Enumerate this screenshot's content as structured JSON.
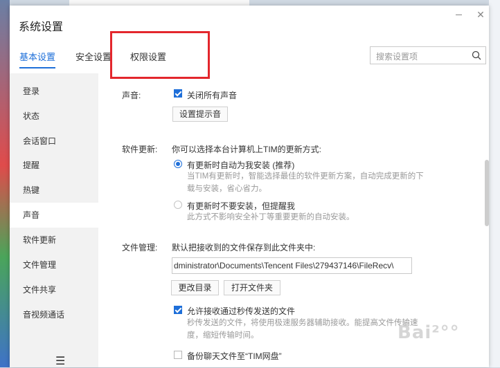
{
  "window": {
    "title": "系统设置"
  },
  "tabs": [
    {
      "label": "基本设置",
      "active": true
    },
    {
      "label": "安全设置",
      "active": false
    },
    {
      "label": "权限设置",
      "active": false
    }
  ],
  "search": {
    "placeholder": "搜索设置项"
  },
  "sidebar": {
    "items": [
      {
        "label": "登录"
      },
      {
        "label": "状态"
      },
      {
        "label": "会话窗口"
      },
      {
        "label": "提醒"
      },
      {
        "label": "热键"
      },
      {
        "label": "声音",
        "active": true
      },
      {
        "label": "软件更新"
      },
      {
        "label": "文件管理"
      },
      {
        "label": "文件共享"
      },
      {
        "label": "音视频通话"
      }
    ]
  },
  "sound": {
    "label": "声音:",
    "mute_all_label": "关闭所有声音",
    "mute_all_checked": true,
    "set_tone_button": "设置提示音"
  },
  "update": {
    "label": "软件更新:",
    "intro": "你可以选择本台计算机上TIM的更新方式:",
    "option_auto": {
      "label": "有更新时自动为我安装 (推荐)",
      "desc_line1": "当TIM有更新时，智能选择最佳的软件更新方案，自动完成更新的下",
      "desc_line2": "载与安装，省心省力。",
      "checked": true
    },
    "option_notify": {
      "label": "有更新时不要安装，但提醒我",
      "desc": "此方式不影响安全补丁等重要更新的自动安装。",
      "checked": false
    }
  },
  "file": {
    "label": "文件管理:",
    "intro": "默认把接收到的文件保存到此文件夹中:",
    "path_value": "dministrator\\Documents\\Tencent Files\\279437146\\FileRecv\\",
    "change_dir_button": "更改目录",
    "open_folder_button": "打开文件夹",
    "fast_send": {
      "label": "允许接收通过秒传发送的文件",
      "checked": true,
      "desc_line1": "秒传发送的文件，将使用极速服务器辅助接收。能提高文件传输速",
      "desc_line2": "度，缩短传输时间。"
    },
    "backup": {
      "label": "备份聊天文件至“TIM网盘”",
      "checked": false
    }
  },
  "watermark": {
    "text": "Bai²°°"
  },
  "colors": {
    "accent": "#1e6fd9",
    "highlight": "#e3262c"
  }
}
